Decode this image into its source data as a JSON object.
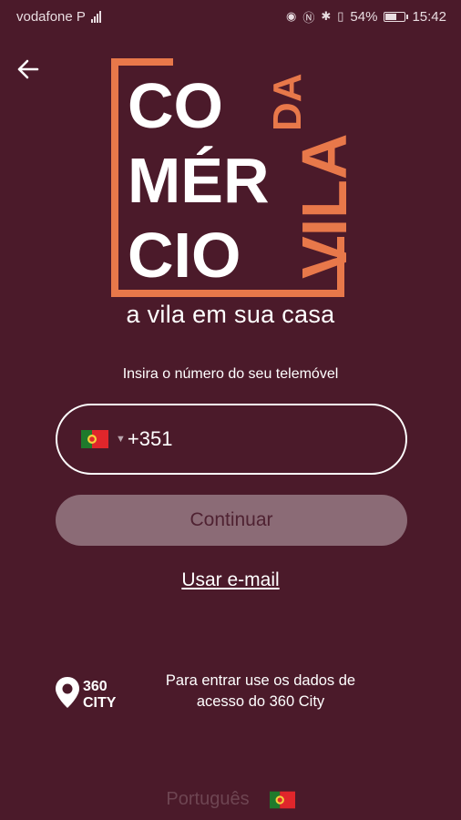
{
  "status_bar": {
    "carrier": "vodafone P",
    "battery": "54%",
    "time": "15:42"
  },
  "brand": {
    "logo_lines": [
      "CO",
      "MÉR",
      "CIO"
    ],
    "logo_side_top": "DA",
    "logo_side_bottom": "VILA",
    "tagline": "a vila em sua casa",
    "accent_color": "#e8784a"
  },
  "login": {
    "prompt": "Insira o número do seu telemóvel",
    "country_flag": "portugal-flag",
    "dial_code": "+351",
    "continue_label": "Continuar",
    "use_email_label": "Usar e-mail"
  },
  "footer": {
    "city_logo_text": [
      "360",
      "CITY"
    ],
    "note": "Para entrar use os dados de acesso do 360 City",
    "language_label": "Português",
    "language_flag": "portugal-flag"
  },
  "colors": {
    "background": "#4b1a2a",
    "button_disabled_bg": "#8b6b76"
  }
}
